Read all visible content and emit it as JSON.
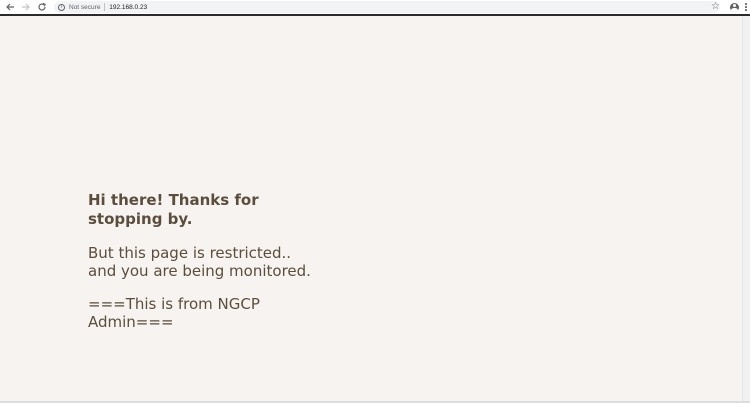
{
  "browser": {
    "security_label": "Not secure",
    "url": "192.168.0.23",
    "icons": {
      "back": "arrow-left-icon",
      "forward": "arrow-right-icon",
      "reload": "reload-icon",
      "info": "info-icon",
      "bookmark": "star-icon",
      "profile": "profile-icon",
      "menu": "kebab-menu-icon"
    }
  },
  "page": {
    "greeting": "Hi there! Thanks for stopping by.",
    "message_line1": "But this page is restricted..",
    "message_line2": "and you are being monitored.",
    "signature": "===This is from NGCP Admin===",
    "background_color": "#f6f3f0",
    "text_color": "#5b4e3d"
  }
}
